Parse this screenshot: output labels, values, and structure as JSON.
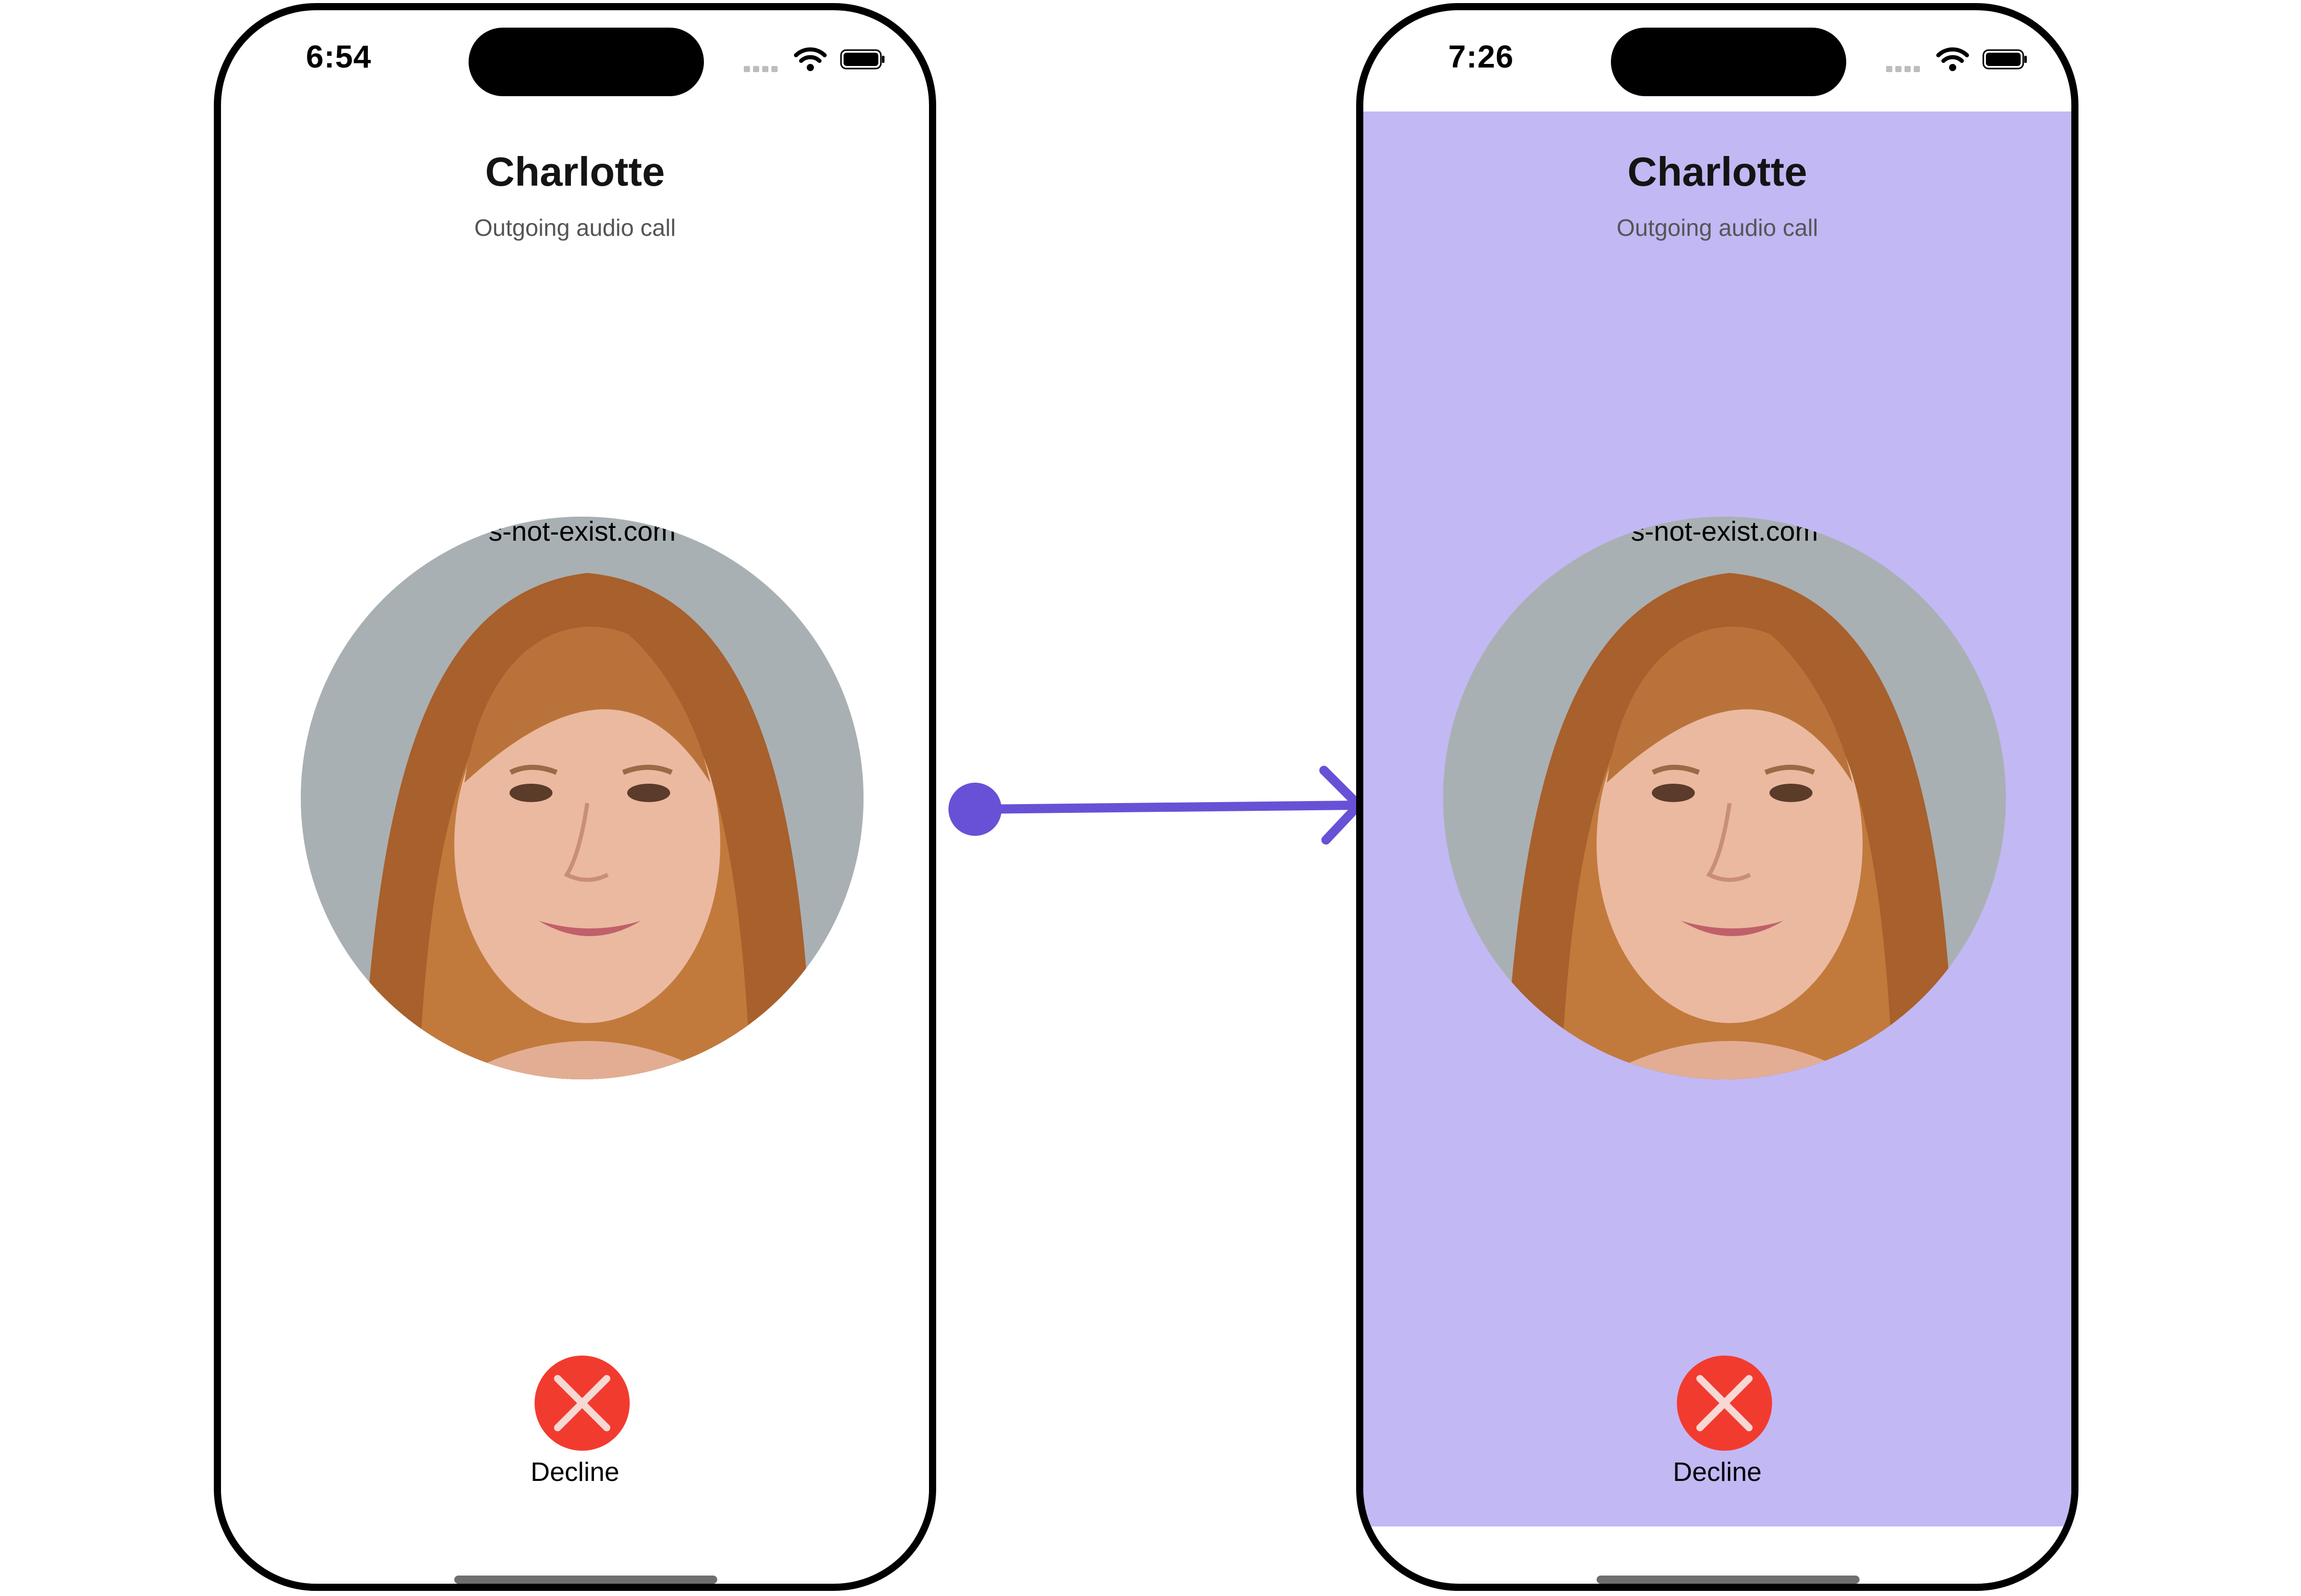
{
  "screens": [
    {
      "status_time": "6:54",
      "contact_name": "Charlotte",
      "call_status": "Outgoing audio call",
      "avatar_watermark": "s-not-exist.com",
      "decline_label": "Decline",
      "background_color": "#ffffff"
    },
    {
      "status_time": "7:26",
      "contact_name": "Charlotte",
      "call_status": "Outgoing audio call",
      "avatar_watermark": "s-not-exist.com",
      "decline_label": "Decline",
      "background_color": "#c2b8f4"
    }
  ],
  "colors": {
    "decline_button": "#f23b2f",
    "arrow": "#6851d6",
    "frame": "#000000"
  },
  "icons": [
    "signal-dots-icon",
    "wifi-icon",
    "battery-icon",
    "close-icon",
    "transition-arrow-icon"
  ]
}
